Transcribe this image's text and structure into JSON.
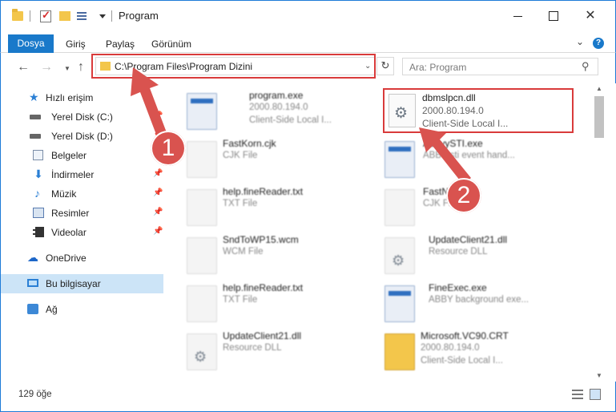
{
  "window": {
    "title": "Program",
    "colors": {
      "accent": "#1979ca",
      "highlight": "#d93b3b",
      "selected": "#cce4f7"
    }
  },
  "ribbon": {
    "tabs": [
      {
        "label": "Dosya"
      },
      {
        "label": "Giriş"
      },
      {
        "label": "Paylaş"
      },
      {
        "label": "Görünüm"
      }
    ],
    "help_label": "?"
  },
  "address": {
    "path": "C:\\Program Files\\Program Dizini",
    "search_placeholder": "Ara: Program"
  },
  "sidebar": {
    "items": [
      {
        "label": "Hızlı erişim",
        "icon": "star-icon"
      },
      {
        "label": "Yerel Disk (C:)",
        "icon": "drive-icon"
      },
      {
        "label": "Yerel Disk (D:)",
        "icon": "drive-icon"
      },
      {
        "label": "Belgeler",
        "icon": "documents-icon"
      },
      {
        "label": "İndirmeler",
        "icon": "download-icon"
      },
      {
        "label": "Müzik",
        "icon": "music-icon"
      },
      {
        "label": "Resimler",
        "icon": "pictures-icon"
      },
      {
        "label": "Videolar",
        "icon": "video-icon"
      },
      {
        "label": "OneDrive",
        "icon": "cloud-icon"
      },
      {
        "label": "Bu bilgisayar",
        "icon": "computer-icon"
      },
      {
        "label": "Ağ",
        "icon": "network-icon"
      }
    ]
  },
  "files": [
    {
      "name": "program.exe",
      "line2": "2000.80.194.0",
      "line3": "Client-Side Local I...",
      "icon": "exe-icon"
    },
    {
      "name": "dbmslpcn.dll",
      "line2": "2000.80.194.0",
      "line3": "Client-Side Local I...",
      "icon": "dll-gear-icon"
    },
    {
      "name": "FastKorn.cjk",
      "line2": "CJK File",
      "line3": "",
      "icon": "file-icon"
    },
    {
      "name": "AbbyySTI.exe",
      "line2": "ABBY sti event hand...",
      "line3": "",
      "icon": "exe-icon"
    },
    {
      "name": "help.fineReader.txt",
      "line2": "TXT File",
      "line3": "",
      "icon": "file-icon"
    },
    {
      "name": "FastNum.cjk",
      "line2": "CJK File",
      "line3": "",
      "icon": "file-icon"
    },
    {
      "name": "SndToWP15.wcm",
      "line2": "WCM File",
      "line3": "",
      "icon": "file-icon"
    },
    {
      "name": "UpdateClient21.dll",
      "line2": "Resource DLL",
      "line3": "",
      "icon": "dll-gear-icon"
    },
    {
      "name": "help.fineReader.txt",
      "line2": "TXT File",
      "line3": "",
      "icon": "file-icon"
    },
    {
      "name": "FineExec.exe",
      "line2": "ABBY background exe...",
      "line3": "",
      "icon": "exe-icon"
    },
    {
      "name": "UpdateClient21.dll",
      "line2": "Resource DLL",
      "line3": "",
      "icon": "dll-gear-icon"
    },
    {
      "name": "Microsoft.VC90.CRT",
      "line2": "2000.80.194.0",
      "line3": "Client-Side Local I...",
      "icon": "folder-stack-icon"
    }
  ],
  "status": {
    "count": "129 öğe"
  },
  "callouts": {
    "one": "1",
    "two": "2"
  }
}
